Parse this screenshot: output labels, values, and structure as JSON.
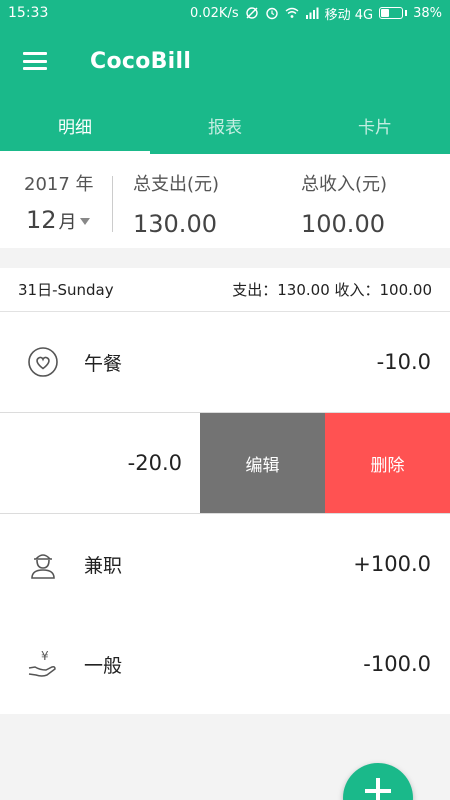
{
  "status_bar": {
    "time": "15:33",
    "speed": "0.02K/s",
    "carrier": "移动 4G",
    "battery": "38%",
    "battery_level": 0.38
  },
  "app_bar": {
    "title": "CocoBill",
    "menu_icon": "menu-icon",
    "color": "#1ab98a"
  },
  "tabs": [
    {
      "label": "明细",
      "active": true
    },
    {
      "label": "报表",
      "active": false
    },
    {
      "label": "卡片",
      "active": false
    }
  ],
  "summary": {
    "year": "2017 年",
    "month": "12",
    "month_unit": "月",
    "expense_label": "总支出(元)",
    "expense_value": "130.00",
    "income_label": "总收入(元)",
    "income_value": "100.00"
  },
  "day": {
    "date": "31日-Sunday",
    "stats": "支出：130.00 收入：100.00"
  },
  "records": [
    {
      "icon": "heart-icon",
      "name": "午餐",
      "amount": "-10.0"
    },
    {
      "amount": "-20.0",
      "edit_label": "编辑",
      "delete_label": "删除",
      "edit_color": "#737373",
      "delete_color": "#ff5252"
    },
    {
      "icon": "person-icon",
      "name": "兼职",
      "amount": "+100.0"
    },
    {
      "icon": "yen-hand-icon",
      "name": "一般",
      "amount": "-100.0"
    }
  ],
  "fab": {
    "icon": "plus-icon"
  }
}
